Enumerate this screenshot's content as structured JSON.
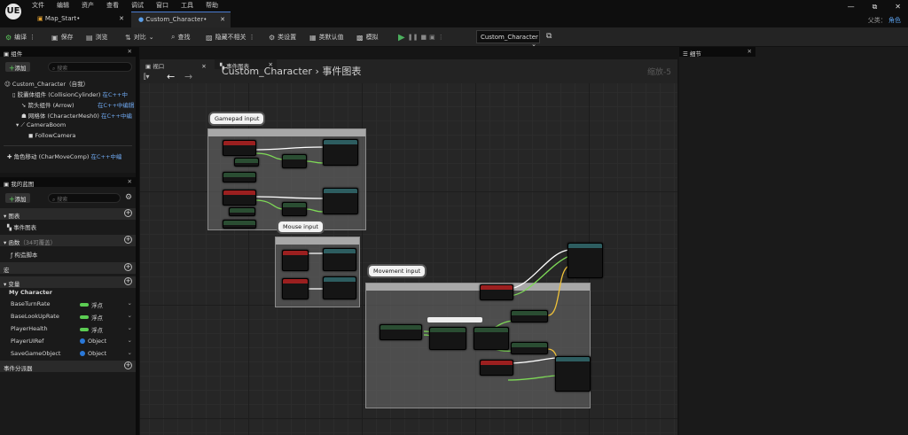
{
  "app": {
    "logo": "UE"
  },
  "menu": [
    "文件",
    "编辑",
    "资产",
    "查看",
    "调试",
    "窗口",
    "工具",
    "帮助"
  ],
  "tabs": [
    {
      "label": "Map_Start•"
    },
    {
      "label": "Custom_Character•"
    }
  ],
  "window": {
    "minimize": "—",
    "restore": "⧉",
    "close": "✕"
  },
  "parent_class": {
    "label": "父类：",
    "value": "角色"
  },
  "toolbar": {
    "compile": "编译",
    "save": "保存",
    "browse": "浏览",
    "diff": "对比",
    "find": "查找",
    "hide_unrelated": "隐藏不相关",
    "class_settings": "类设置",
    "class_defaults": "类默认值",
    "simulate": "模拟",
    "debug_object": "Custom_Character"
  },
  "components": {
    "title": "组件",
    "add": "添加",
    "search_placeholder": "搜索",
    "items": [
      {
        "name": "Custom_Character（自我）",
        "note": ""
      },
      {
        "name": "胶囊体组件 (CollisionCylinder)",
        "note": "在C++中"
      },
      {
        "name": "箭头组件 (Arrow)",
        "note": "在C++中编辑"
      },
      {
        "name": "网格体 (CharacterMesh0)",
        "note": "在C++中编"
      },
      {
        "name": "CameraBoom",
        "note": ""
      },
      {
        "name": "FollowCamera",
        "note": ""
      },
      {
        "name": "角色移动 (CharMoveComp)",
        "note": "在C++中编"
      }
    ]
  },
  "my_blueprint": {
    "title": "我的蓝图",
    "add": "添加",
    "search_placeholder": "搜索",
    "sections": {
      "graphs": "图表",
      "event_graph": "事件图表",
      "functions": "函数",
      "functions_note": "（34可覆盖）",
      "construction": "构造脚本",
      "macros": "宏",
      "variables": "变量",
      "category": "My Character",
      "dispatchers": "事件分派器"
    },
    "variables": [
      {
        "name": "BaseTurnRate",
        "type": "浮点"
      },
      {
        "name": "BaseLookUpRate",
        "type": "浮点"
      },
      {
        "name": "PlayerHealth",
        "type": "浮点"
      },
      {
        "name": "PlayerUIRef",
        "type": "Object"
      },
      {
        "name": "SaveGameObject",
        "type": "Object"
      }
    ]
  },
  "graph": {
    "viewport_tab": "视口",
    "event_graph_tab": "事件图表",
    "breadcrumb_root": "Custom_Character",
    "breadcrumb_sep": "›",
    "breadcrumb_leaf": "事件图表",
    "zoom": "缩放-5",
    "comments": [
      {
        "label": "Gamepad input"
      },
      {
        "label": "Mouse input"
      },
      {
        "label": "Movement input"
      }
    ]
  },
  "details": {
    "title": "细节"
  },
  "colors": {
    "accent": "#4a7bd0",
    "play": "#4cb05e",
    "float_pin": "#5ccd53",
    "object_pin": "#2a78d8",
    "exec_wire": "#ffffff",
    "float_wire": "#7ed957",
    "yellow_wire": "#f0c23a"
  }
}
